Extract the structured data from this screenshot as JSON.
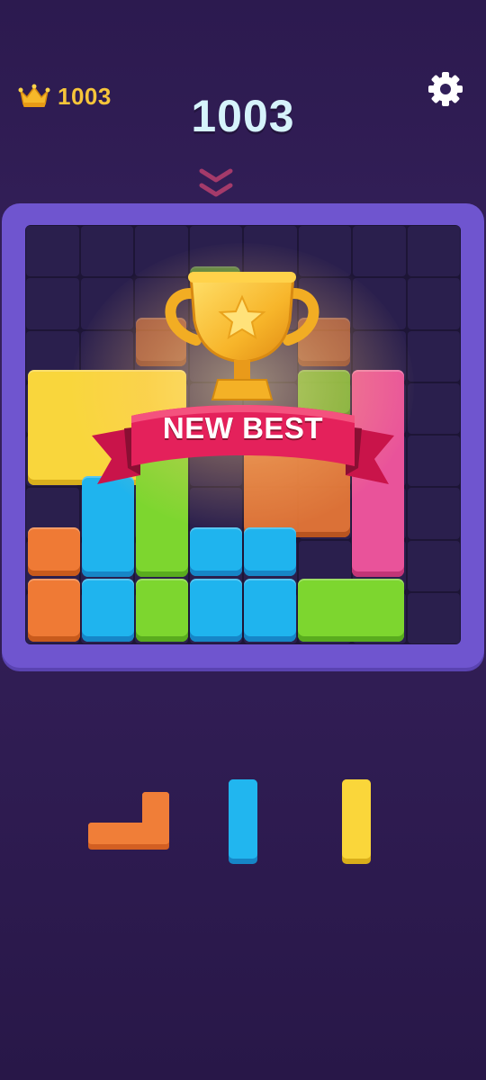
{
  "hud": {
    "best_score": "1003",
    "current_score": "1003"
  },
  "icons": {
    "crown": "crown-icon",
    "settings": "gear-icon",
    "drop_indicator": "double-chevron-down-icon"
  },
  "celebration": {
    "banner_text": "NEW BEST"
  },
  "board": {
    "grid": "8x8",
    "colors": {
      "yellow": "#f9d63c",
      "orange": "#ef7a35",
      "blue": "#1fb4ee",
      "green": "#7dd62f",
      "pink": "#e9539a",
      "empty_cell": "#2a1f4d",
      "frame": "#6f55cf"
    }
  },
  "tray": {
    "pieces": [
      "orange-l-piece",
      "blue-vertical-bar",
      "yellow-vertical-bar"
    ]
  }
}
